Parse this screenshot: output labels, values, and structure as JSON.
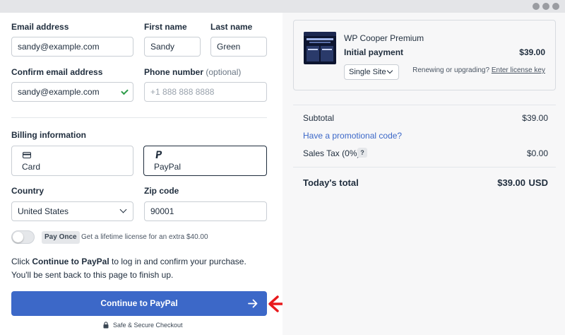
{
  "form": {
    "email_label": "Email address",
    "email_value": "sandy@example.com",
    "first_name_label": "First name",
    "first_name_value": "Sandy",
    "last_name_label": "Last name",
    "last_name_value": "Green",
    "confirm_email_label": "Confirm email address",
    "confirm_email_value": "sandy@example.com",
    "phone_label": "Phone number",
    "phone_optional": "(optional)",
    "phone_placeholder": "+1 888 888 8888",
    "billing_label": "Billing information",
    "methods": [
      {
        "label": "Card",
        "selected": false
      },
      {
        "label": "PayPal",
        "selected": true
      }
    ],
    "country_label": "Country",
    "country_value": "United States",
    "zip_label": "Zip code",
    "zip_value": "90001",
    "pay_once_badge": "Pay Once",
    "lifetime_text": "Get a lifetime license for an extra $40.00",
    "message_prefix": "Click ",
    "message_bold": "Continue to PayPal",
    "message_suffix": " to log in and confirm your purchase. You'll be sent back to this page to finish up.",
    "cta_label": "Continue to PayPal",
    "secure_text": "Safe & Secure Checkout"
  },
  "summary": {
    "product_name": "WP Cooper Premium",
    "payment_label": "Initial payment",
    "payment_price": "$39.00",
    "site_option": "Single Site",
    "renew_prefix": "Renewing or upgrading?",
    "renew_link": "Enter license key",
    "subtotal_label": "Subtotal",
    "subtotal_value": "$39.00",
    "promo_link": "Have a promotional code?",
    "tax_label": "Sales Tax (0%)",
    "tax_help": "?",
    "tax_value": "$0.00",
    "total_label": "Today's total",
    "total_value": "$39.00",
    "total_currency": "USD"
  },
  "colors": {
    "accent": "#3c68c8",
    "check": "#2e9c4a",
    "annotation_arrow": "#e8191c"
  }
}
